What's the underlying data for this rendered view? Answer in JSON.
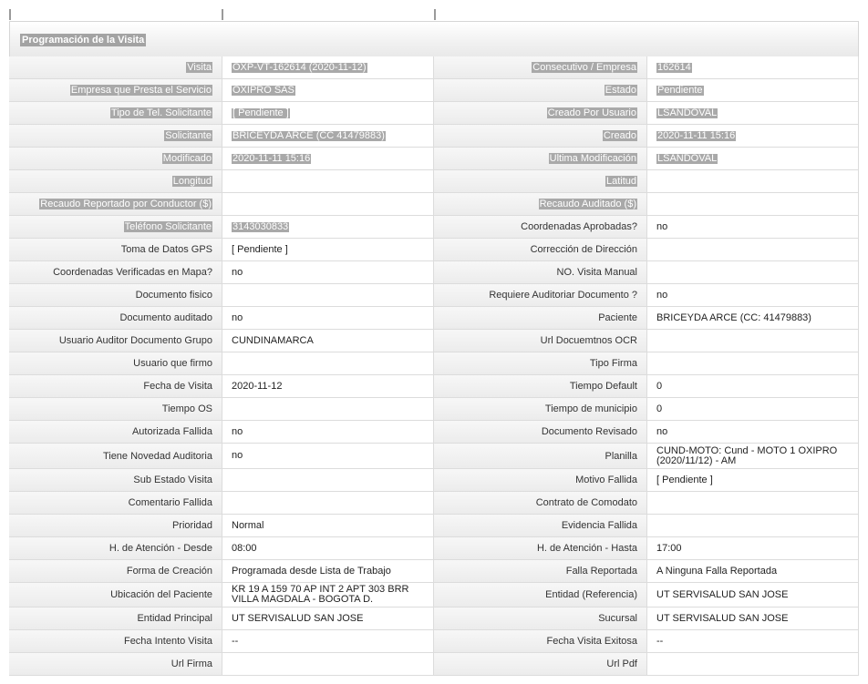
{
  "section_title": "Programación de la Visita",
  "rows": [
    {
      "l1": "Visita",
      "v1": "OXP-VT-162614 (2020-11-12)",
      "l2": "Consecutivo / Empresa",
      "v2": "162614"
    },
    {
      "l1": "Empresa que Presta el Servicio",
      "v1": "OXIPRO SAS",
      "l2": "Estado",
      "v2": "Pendiente"
    },
    {
      "l1": "Tipo de Tel. Solicitante",
      "v1": "[ Pendiente ]",
      "l2": "Creado Por Usuario",
      "v2": "LSANDOVAL"
    },
    {
      "l1": "Solicitante",
      "v1": "BRICEYDA ARCE (CC 41479883)",
      "l2": "Creado",
      "v2": "2020-11-11 15:16"
    },
    {
      "l1": "Modificado",
      "v1": "2020-11-11 15:16",
      "l2": "Ultima Modificación",
      "v2": "LSANDOVAL"
    },
    {
      "l1": "Longitud",
      "v1": "",
      "l2": "Latitud",
      "v2": ""
    },
    {
      "l1": "Recaudo Reportado por Conductor ($)",
      "v1": "",
      "l2": "Recaudo Auditado ($)",
      "v2": ""
    },
    {
      "l1": "Teléfono Solicitante",
      "v1": "3143030833",
      "l2": "Coordenadas Aprobadas?",
      "v2": "no"
    },
    {
      "l1": "Toma de Datos GPS",
      "v1": "[ Pendiente ]",
      "l2": "Corrección de Dirección",
      "v2": ""
    },
    {
      "l1": "Coordenadas Verificadas en Mapa?",
      "v1": "no",
      "l2": "NO. Visita Manual",
      "v2": ""
    },
    {
      "l1": "Documento fisico",
      "v1": "",
      "l2": "Requiere Auditoriar Documento ?",
      "v2": "no"
    },
    {
      "l1": "Documento auditado",
      "v1": "no",
      "l2": "Paciente",
      "v2": "BRICEYDA ARCE (CC: 41479883)"
    },
    {
      "l1": "Usuario Auditor Documento Grupo",
      "v1": "CUNDINAMARCA",
      "l2": "Url Docuemtnos OCR",
      "v2": ""
    },
    {
      "l1": "Usuario que firmo",
      "v1": "",
      "l2": "Tipo Firma",
      "v2": ""
    },
    {
      "l1": "Fecha de Visita",
      "v1": "2020-11-12",
      "l2": "Tiempo Default",
      "v2": "0"
    },
    {
      "l1": "Tiempo OS",
      "v1": "",
      "l2": "Tiempo de municipio",
      "v2": "0"
    },
    {
      "l1": "Autorizada Fallida",
      "v1": "no",
      "l2": "Documento Revisado",
      "v2": "no"
    },
    {
      "l1": "Tiene Novedad Auditoria",
      "v1": "no",
      "l2": "Planilla",
      "v2": "CUND-MOTO: Cund - MOTO 1 OXIPRO (2020/11/12) - AM"
    },
    {
      "l1": "Sub Estado Visita",
      "v1": "",
      "l2": "Motivo Fallida",
      "v2": "[ Pendiente ]"
    },
    {
      "l1": "Comentario Fallida",
      "v1": "",
      "l2": "Contrato de Comodato",
      "v2": ""
    },
    {
      "l1": "Prioridad",
      "v1": "Normal",
      "l2": "Evidencia Fallida",
      "v2": ""
    },
    {
      "l1": "H. de Atención - Desde",
      "v1": "08:00",
      "l2": "H. de Atención - Hasta",
      "v2": "17:00"
    },
    {
      "l1": "Forma de Creación",
      "v1": "Programada desde Lista de Trabajo",
      "l2": "Falla Reportada",
      "v2": "A Ninguna Falla Reportada"
    },
    {
      "l1": "Ubicación del Paciente",
      "v1": "KR 19 A 159 70 AP INT 2 APT 303 BRR VILLA MAGDALA - BOGOTA D.",
      "l2": "Entidad (Referencia)",
      "v2": "UT SERVISALUD SAN JOSE"
    },
    {
      "l1": "Entidad Principal",
      "v1": "UT SERVISALUD SAN JOSE",
      "l2": "Sucursal",
      "v2": "UT SERVISALUD SAN JOSE"
    },
    {
      "l1": "Fecha Intento Visita",
      "v1": "--",
      "l2": "Fecha Visita Exitosa",
      "v2": "--"
    },
    {
      "l1": "Url Firma",
      "v1": "",
      "l2": "Url Pdf",
      "v2": ""
    }
  ]
}
